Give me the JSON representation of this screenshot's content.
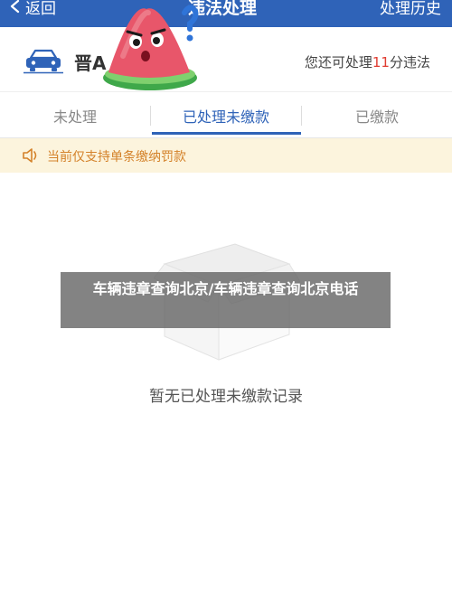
{
  "nav": {
    "back_label": "返回",
    "title": "违法处理",
    "history_label": "处理历史",
    "bg_color": "#2f63b8"
  },
  "vehicle": {
    "plate": "晋A",
    "remain_prefix": "您还可处理",
    "remain_count": "11",
    "remain_suffix": "分违法",
    "icon": "car-icon"
  },
  "tabs": [
    {
      "label": "未处理",
      "active": false
    },
    {
      "label": "已处理未缴款",
      "active": true
    },
    {
      "label": "已缴款",
      "active": false
    }
  ],
  "notice": {
    "icon": "speaker-icon",
    "text": "当前仅支持单条缴纳罚款"
  },
  "empty_state": {
    "icon": "empty-box-icon",
    "text": "暂无已处理未缴款记录"
  },
  "watermark": {
    "text": "车辆违章查询北京/车辆违章查询北京电话"
  },
  "decoration": {
    "mascot": "watermelon-mascot"
  },
  "colors": {
    "accent": "#2f63b8",
    "alert": "#e03c31",
    "notice_bg": "#fcf4dd",
    "notice_text": "#d4822a"
  }
}
